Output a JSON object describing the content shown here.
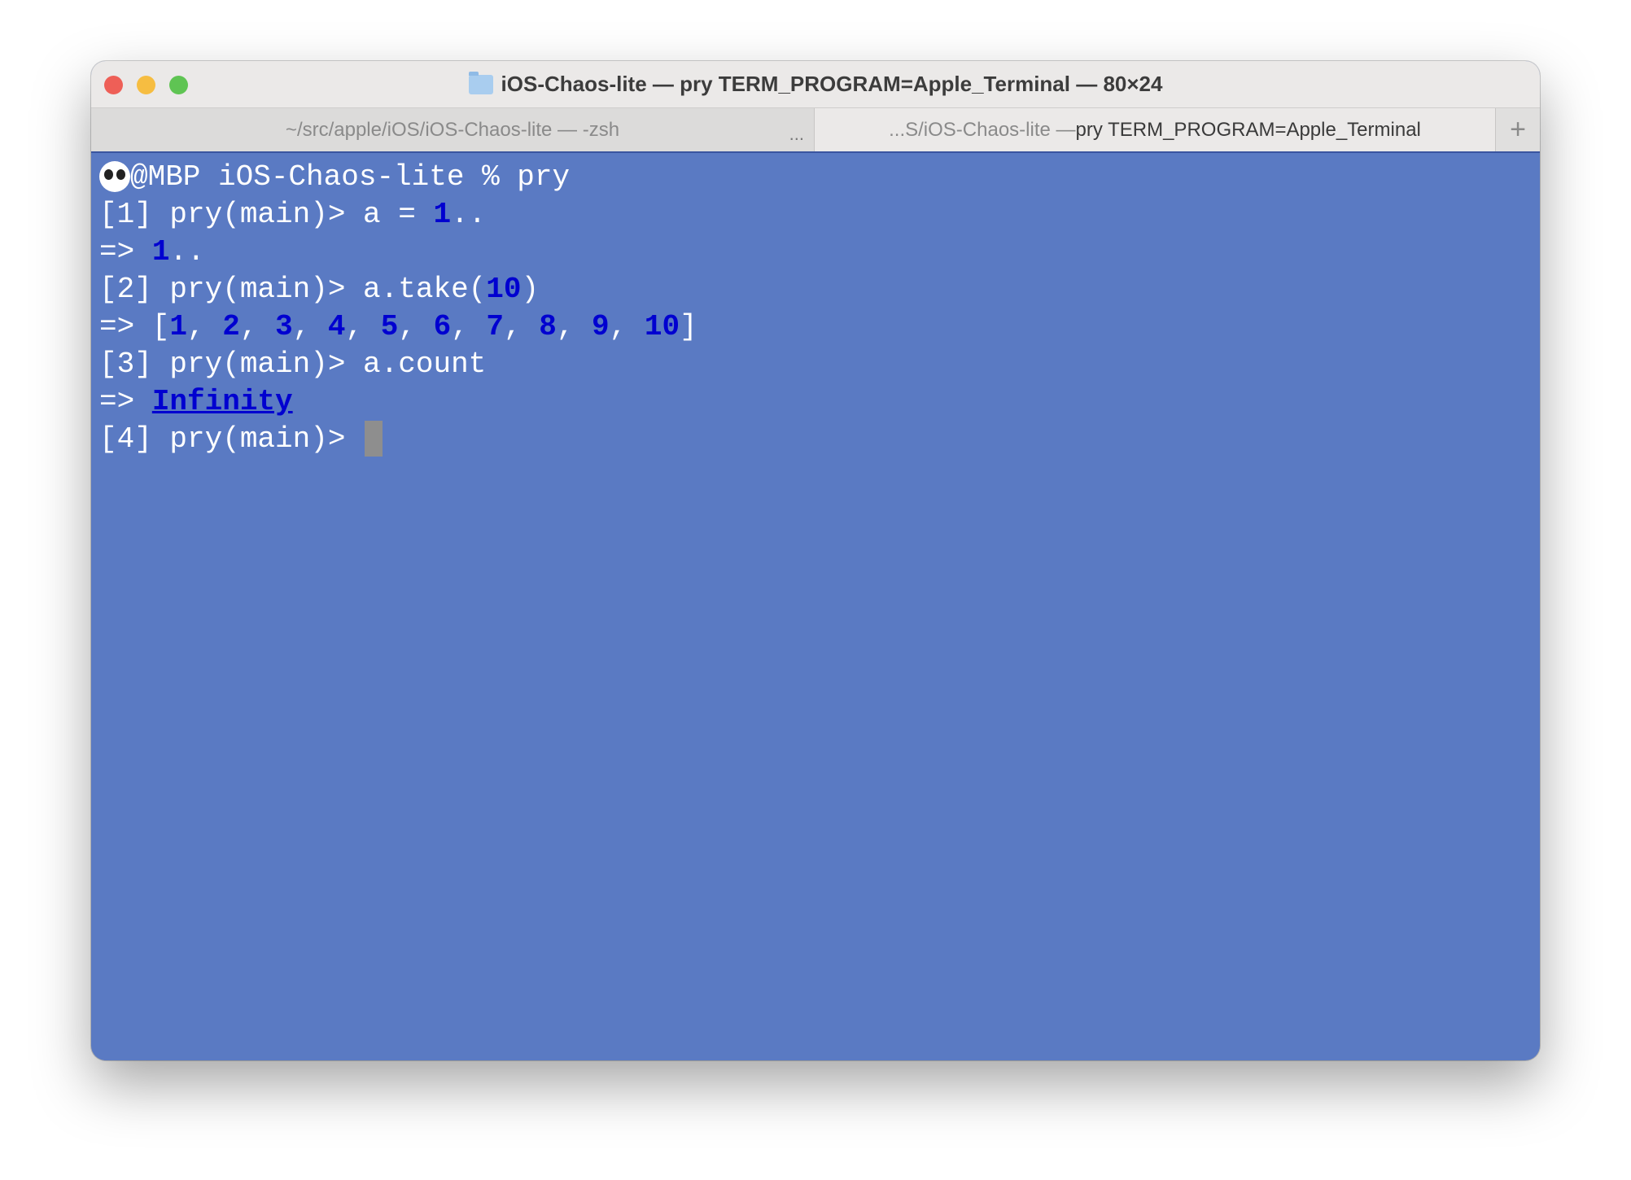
{
  "window": {
    "title": "iOS-Chaos-lite — pry TERM_PROGRAM=Apple_Terminal — 80×24",
    "traffic_lights": {
      "close": "#ee5f57",
      "minimize": "#f6bd41",
      "zoom": "#5fc453"
    }
  },
  "tabs": [
    {
      "label": "~/src/apple/iOS/iOS-Chaos-lite — -zsh",
      "overflow": "...",
      "active": false
    },
    {
      "label_dim": "...S/iOS-Chaos-lite — ",
      "label": "pry TERM_PROGRAM=Apple_Terminal",
      "active": true
    }
  ],
  "new_tab": "+",
  "terminal": {
    "background": "#5a7ac3",
    "prompt_user_icon": "panda-icon",
    "l0": "@MBP iOS-Chaos-lite % pry",
    "l1a": "[1] pry(main)> a = ",
    "l1n": "1",
    "l1b": "..",
    "l2a": "=> ",
    "l2n": "1",
    "l2b": "..",
    "l3a": "[2] pry(main)> a.take(",
    "l3n": "10",
    "l3b": ")",
    "l4a": "=> [",
    "l4": [
      "1",
      "2",
      "3",
      "4",
      "5",
      "6",
      "7",
      "8",
      "9",
      "10"
    ],
    "l4sep": ", ",
    "l4b": "]",
    "l5": "[3] pry(main)> a.count",
    "l6a": "=> ",
    "l6n": "Infinity",
    "l7": "[4] pry(main)> "
  }
}
